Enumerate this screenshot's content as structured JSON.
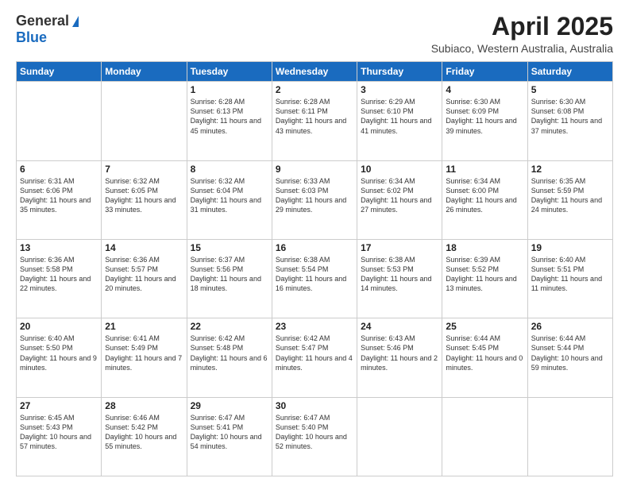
{
  "logo": {
    "general": "General",
    "blue": "Blue"
  },
  "header": {
    "title": "April 2025",
    "subtitle": "Subiaco, Western Australia, Australia"
  },
  "days_of_week": [
    "Sunday",
    "Monday",
    "Tuesday",
    "Wednesday",
    "Thursday",
    "Friday",
    "Saturday"
  ],
  "weeks": [
    [
      {
        "day": "",
        "info": ""
      },
      {
        "day": "",
        "info": ""
      },
      {
        "day": "1",
        "info": "Sunrise: 6:28 AM\nSunset: 6:13 PM\nDaylight: 11 hours and 45 minutes."
      },
      {
        "day": "2",
        "info": "Sunrise: 6:28 AM\nSunset: 6:11 PM\nDaylight: 11 hours and 43 minutes."
      },
      {
        "day": "3",
        "info": "Sunrise: 6:29 AM\nSunset: 6:10 PM\nDaylight: 11 hours and 41 minutes."
      },
      {
        "day": "4",
        "info": "Sunrise: 6:30 AM\nSunset: 6:09 PM\nDaylight: 11 hours and 39 minutes."
      },
      {
        "day": "5",
        "info": "Sunrise: 6:30 AM\nSunset: 6:08 PM\nDaylight: 11 hours and 37 minutes."
      }
    ],
    [
      {
        "day": "6",
        "info": "Sunrise: 6:31 AM\nSunset: 6:06 PM\nDaylight: 11 hours and 35 minutes."
      },
      {
        "day": "7",
        "info": "Sunrise: 6:32 AM\nSunset: 6:05 PM\nDaylight: 11 hours and 33 minutes."
      },
      {
        "day": "8",
        "info": "Sunrise: 6:32 AM\nSunset: 6:04 PM\nDaylight: 11 hours and 31 minutes."
      },
      {
        "day": "9",
        "info": "Sunrise: 6:33 AM\nSunset: 6:03 PM\nDaylight: 11 hours and 29 minutes."
      },
      {
        "day": "10",
        "info": "Sunrise: 6:34 AM\nSunset: 6:02 PM\nDaylight: 11 hours and 27 minutes."
      },
      {
        "day": "11",
        "info": "Sunrise: 6:34 AM\nSunset: 6:00 PM\nDaylight: 11 hours and 26 minutes."
      },
      {
        "day": "12",
        "info": "Sunrise: 6:35 AM\nSunset: 5:59 PM\nDaylight: 11 hours and 24 minutes."
      }
    ],
    [
      {
        "day": "13",
        "info": "Sunrise: 6:36 AM\nSunset: 5:58 PM\nDaylight: 11 hours and 22 minutes."
      },
      {
        "day": "14",
        "info": "Sunrise: 6:36 AM\nSunset: 5:57 PM\nDaylight: 11 hours and 20 minutes."
      },
      {
        "day": "15",
        "info": "Sunrise: 6:37 AM\nSunset: 5:56 PM\nDaylight: 11 hours and 18 minutes."
      },
      {
        "day": "16",
        "info": "Sunrise: 6:38 AM\nSunset: 5:54 PM\nDaylight: 11 hours and 16 minutes."
      },
      {
        "day": "17",
        "info": "Sunrise: 6:38 AM\nSunset: 5:53 PM\nDaylight: 11 hours and 14 minutes."
      },
      {
        "day": "18",
        "info": "Sunrise: 6:39 AM\nSunset: 5:52 PM\nDaylight: 11 hours and 13 minutes."
      },
      {
        "day": "19",
        "info": "Sunrise: 6:40 AM\nSunset: 5:51 PM\nDaylight: 11 hours and 11 minutes."
      }
    ],
    [
      {
        "day": "20",
        "info": "Sunrise: 6:40 AM\nSunset: 5:50 PM\nDaylight: 11 hours and 9 minutes."
      },
      {
        "day": "21",
        "info": "Sunrise: 6:41 AM\nSunset: 5:49 PM\nDaylight: 11 hours and 7 minutes."
      },
      {
        "day": "22",
        "info": "Sunrise: 6:42 AM\nSunset: 5:48 PM\nDaylight: 11 hours and 6 minutes."
      },
      {
        "day": "23",
        "info": "Sunrise: 6:42 AM\nSunset: 5:47 PM\nDaylight: 11 hours and 4 minutes."
      },
      {
        "day": "24",
        "info": "Sunrise: 6:43 AM\nSunset: 5:46 PM\nDaylight: 11 hours and 2 minutes."
      },
      {
        "day": "25",
        "info": "Sunrise: 6:44 AM\nSunset: 5:45 PM\nDaylight: 11 hours and 0 minutes."
      },
      {
        "day": "26",
        "info": "Sunrise: 6:44 AM\nSunset: 5:44 PM\nDaylight: 10 hours and 59 minutes."
      }
    ],
    [
      {
        "day": "27",
        "info": "Sunrise: 6:45 AM\nSunset: 5:43 PM\nDaylight: 10 hours and 57 minutes."
      },
      {
        "day": "28",
        "info": "Sunrise: 6:46 AM\nSunset: 5:42 PM\nDaylight: 10 hours and 55 minutes."
      },
      {
        "day": "29",
        "info": "Sunrise: 6:47 AM\nSunset: 5:41 PM\nDaylight: 10 hours and 54 minutes."
      },
      {
        "day": "30",
        "info": "Sunrise: 6:47 AM\nSunset: 5:40 PM\nDaylight: 10 hours and 52 minutes."
      },
      {
        "day": "",
        "info": ""
      },
      {
        "day": "",
        "info": ""
      },
      {
        "day": "",
        "info": ""
      }
    ]
  ]
}
